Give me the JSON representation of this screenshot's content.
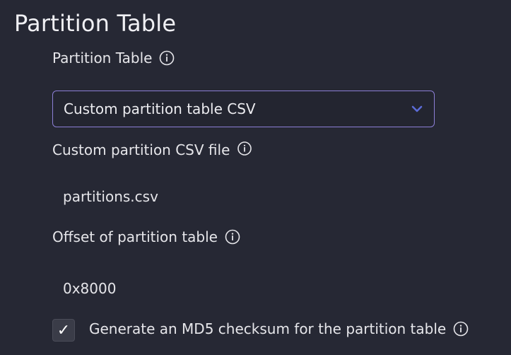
{
  "section_title": "Partition Table",
  "partition_table": {
    "label": "Partition Table",
    "info_icon": "info-icon",
    "selected_value": "Custom partition table CSV",
    "dropdown_icon": "chevron-down-icon",
    "accent_color": "#8c7fd6",
    "chevron_color": "#5b6bd6"
  },
  "custom_csv": {
    "label": "Custom partition CSV file",
    "info_icon": "info-icon",
    "value": "partitions.csv"
  },
  "offset": {
    "label": "Offset of partition table",
    "info_icon": "info-icon",
    "value": "0x8000"
  },
  "md5": {
    "checked": true,
    "check_glyph": "✓",
    "label": "Generate an MD5 checksum for the partition table",
    "info_icon": "info-icon"
  }
}
